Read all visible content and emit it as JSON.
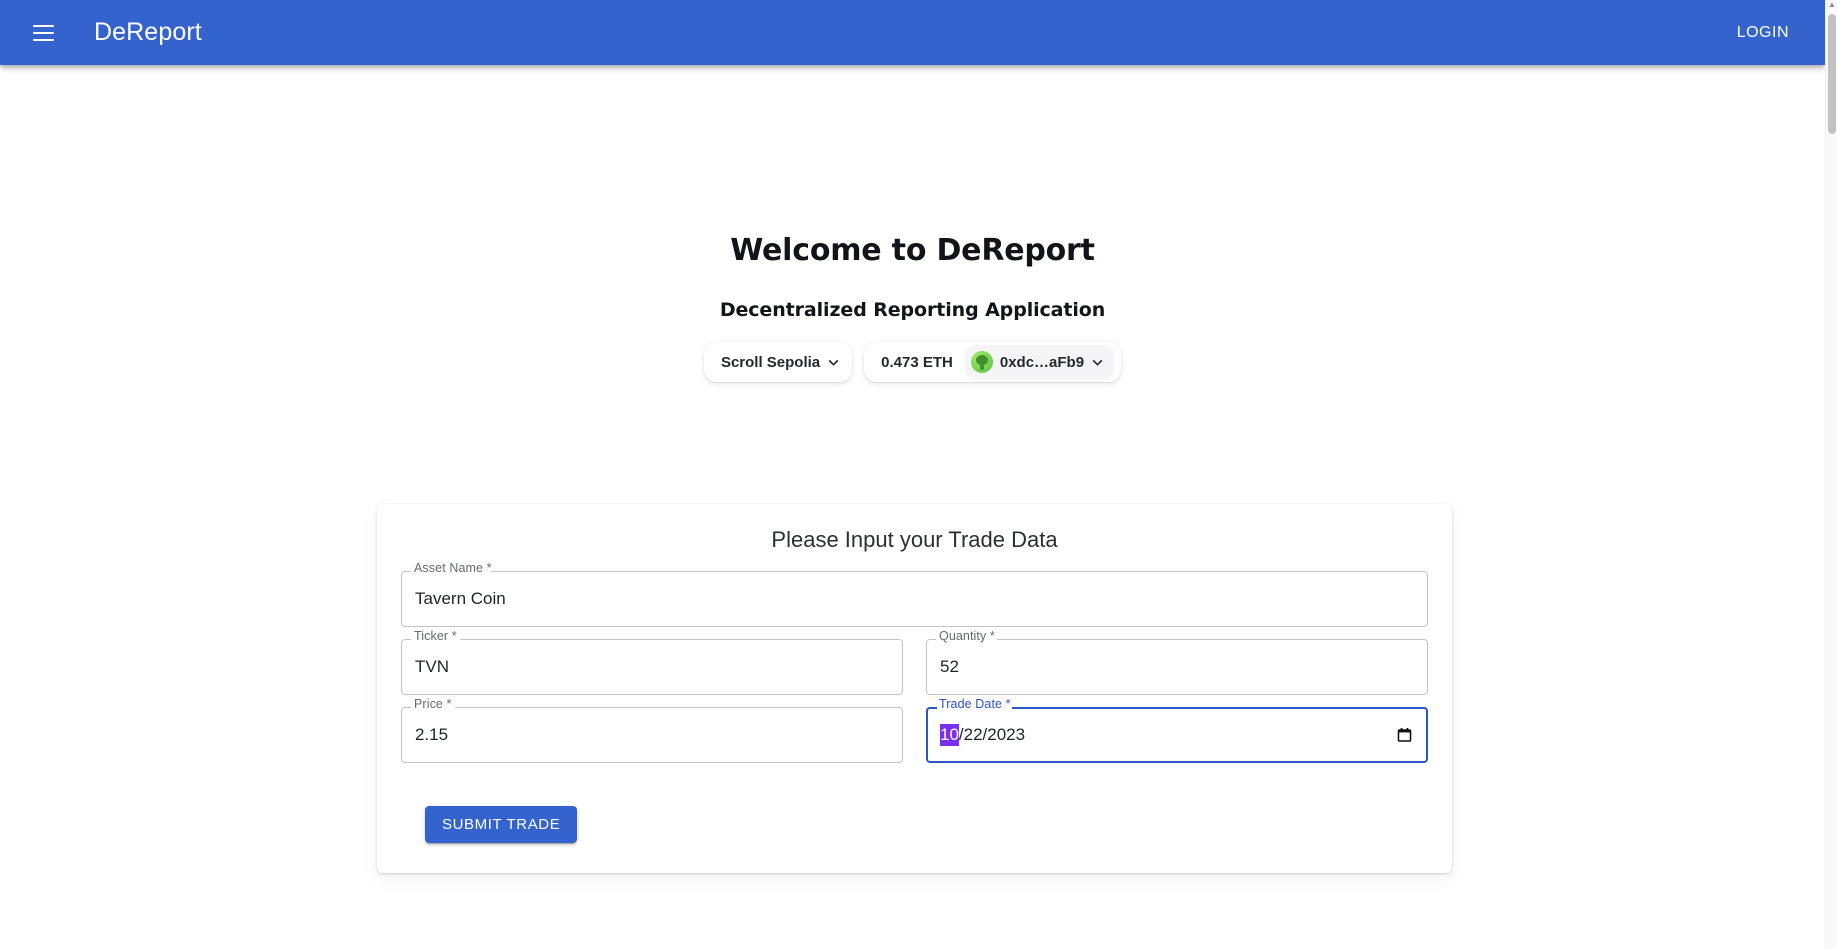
{
  "appbar": {
    "menu_icon": "hamburger-menu-icon",
    "brand": "DeReport",
    "login_label": "LOGIN"
  },
  "hero": {
    "title": "Welcome to DeReport",
    "subtitle": "Decentralized Reporting Application"
  },
  "wallet": {
    "network": "Scroll Sepolia",
    "network_chevron_icon": "chevron-down-icon",
    "balance": "0.473 ETH",
    "address": "0xdc…aFb9",
    "avatar_icon": "wallet-avatar-icon",
    "account_chevron_icon": "chevron-down-icon"
  },
  "form": {
    "title": "Please Input your Trade Data",
    "fields": {
      "asset_name": {
        "label": "Asset Name *",
        "value": "Tavern Coin",
        "placeholder": ""
      },
      "ticker": {
        "label": "Ticker *",
        "value": "TVN",
        "placeholder": ""
      },
      "quantity": {
        "label": "Quantity *",
        "value": "52",
        "placeholder": ""
      },
      "price": {
        "label": "Price *",
        "value": "2.15",
        "placeholder": ""
      },
      "trade_date": {
        "label": "Trade Date *",
        "value": "10/22/2023",
        "selected_segment": "10",
        "remaining_segments": "/22/2023",
        "picker_icon": "calendar-icon"
      }
    },
    "submit_label": "SUBMIT TRADE"
  },
  "colors": {
    "brand_blue": "#3563ce",
    "focus_blue": "#2c55c8",
    "selection_purple": "#7b2ff2",
    "border_grey": "#c4c4c4"
  }
}
